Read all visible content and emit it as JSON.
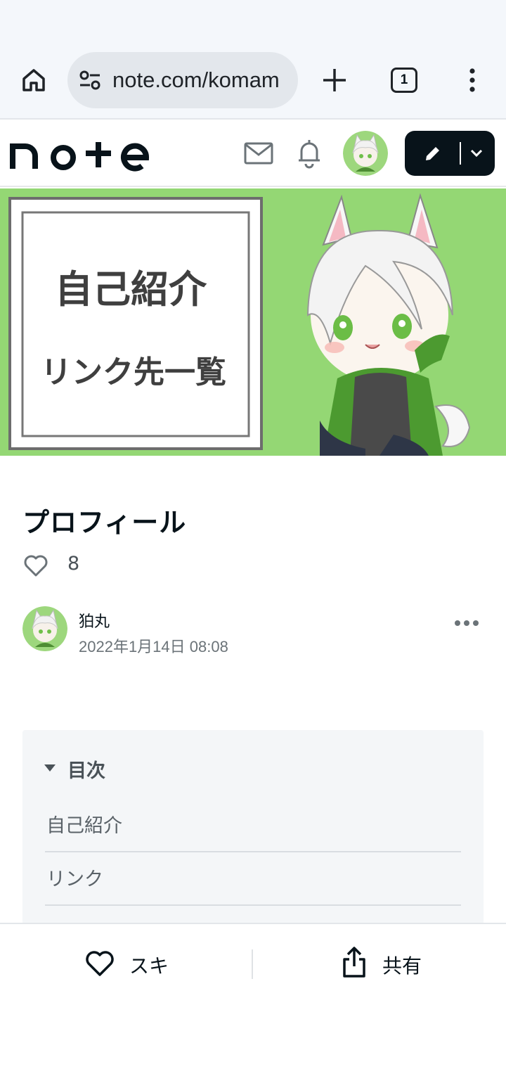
{
  "browser": {
    "url": "note.com/komam",
    "tab_count": "1"
  },
  "site": {
    "logo_text": "note"
  },
  "banner": {
    "line1": "自己紹介",
    "line2": "リンク先一覧",
    "background_color": "#8ad36a"
  },
  "article": {
    "title": "プロフィール",
    "like_count": "8",
    "author_name": "狛丸",
    "date": "2022年1月14日 08:08"
  },
  "toc": {
    "heading": "目次",
    "items": [
      "自己紹介",
      "リンク"
    ]
  },
  "bottom_bar": {
    "like_label": "スキ",
    "share_label": "共有"
  }
}
